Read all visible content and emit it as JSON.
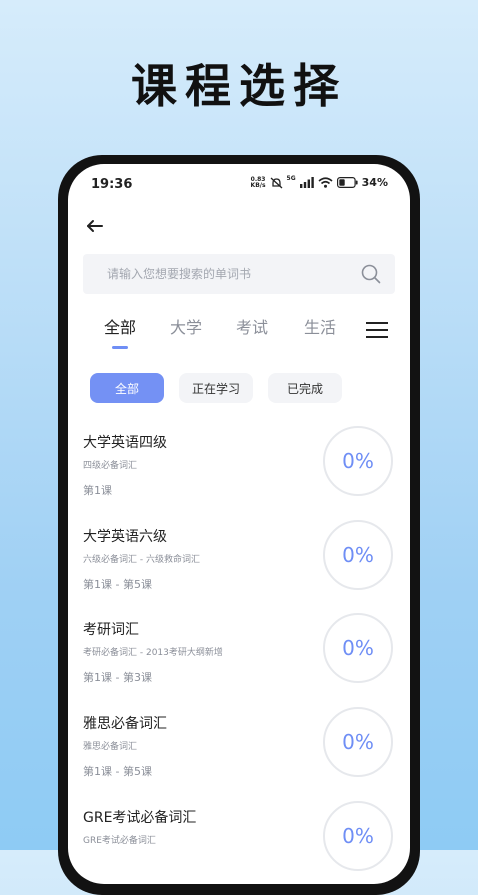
{
  "promo": {
    "title": "课程选择"
  },
  "status_bar": {
    "time": "19:36",
    "net_speed_value": "0.83",
    "net_speed_unit": "KB/s",
    "network_type": "5G",
    "battery": "34%"
  },
  "search": {
    "placeholder": "请输入您想要搜索的单词书"
  },
  "category_tabs": [
    {
      "label": "全部",
      "active": true
    },
    {
      "label": "大学",
      "active": false
    },
    {
      "label": "考试",
      "active": false
    },
    {
      "label": "生活",
      "active": false
    }
  ],
  "filters": [
    {
      "label": "全部",
      "active": true
    },
    {
      "label": "正在学习",
      "active": false
    },
    {
      "label": "已完成",
      "active": false
    }
  ],
  "courses": [
    {
      "title": "大学英语四级",
      "subtitle": "四级必备词汇",
      "lessons": "第1课",
      "progress": "0%"
    },
    {
      "title": "大学英语六级",
      "subtitle": "六级必备词汇 - 六级救命词汇",
      "lessons": "第1课 - 第5课",
      "progress": "0%"
    },
    {
      "title": "考研词汇",
      "subtitle": "考研必备词汇 - 2013考研大纲新增",
      "lessons": "第1课 - 第3课",
      "progress": "0%"
    },
    {
      "title": "雅思必备词汇",
      "subtitle": "雅思必备词汇",
      "lessons": "第1课 - 第5课",
      "progress": "0%"
    },
    {
      "title": "GRE考试必备词汇",
      "subtitle": "GRE考试必备词汇",
      "lessons": "",
      "progress": "0%"
    }
  ],
  "colors": {
    "accent": "#7491f4",
    "progress_text": "#6f8ef5"
  },
  "icons": [
    "back-arrow-icon",
    "search-icon",
    "menu-icon",
    "mute-icon",
    "signal-icon",
    "wifi-icon",
    "battery-icon"
  ]
}
